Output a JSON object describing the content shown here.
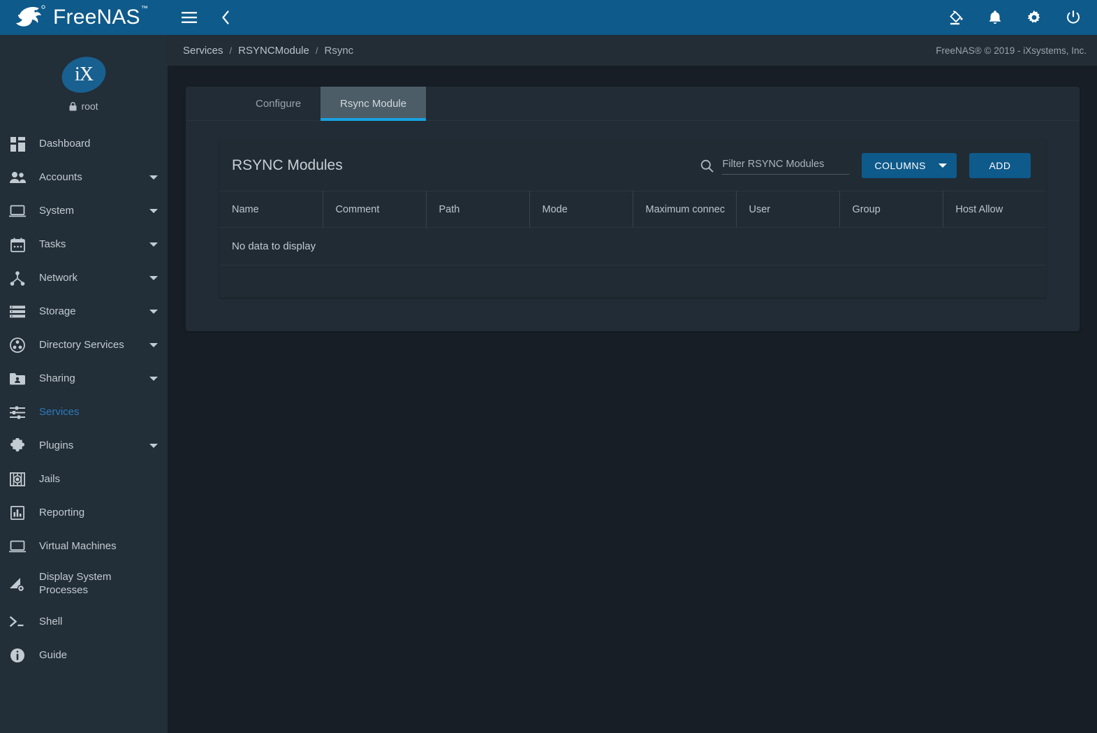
{
  "brand": {
    "name": "FreeNAS",
    "tm": "™",
    "logo_icon": "freenas-fish-logo"
  },
  "sidebar": {
    "user": {
      "name": "root",
      "avatar_text": "iX",
      "lock_icon": "lock-icon"
    },
    "items": [
      {
        "label": "Dashboard",
        "icon": "dashboard-icon",
        "expandable": false,
        "active": false
      },
      {
        "label": "Accounts",
        "icon": "accounts-icon",
        "expandable": true,
        "active": false
      },
      {
        "label": "System",
        "icon": "system-icon",
        "expandable": true,
        "active": false
      },
      {
        "label": "Tasks",
        "icon": "tasks-icon",
        "expandable": true,
        "active": false
      },
      {
        "label": "Network",
        "icon": "network-icon",
        "expandable": true,
        "active": false
      },
      {
        "label": "Storage",
        "icon": "storage-icon",
        "expandable": true,
        "active": false
      },
      {
        "label": "Directory Services",
        "icon": "directory-services-icon",
        "expandable": true,
        "active": false
      },
      {
        "label": "Sharing",
        "icon": "sharing-icon",
        "expandable": true,
        "active": false
      },
      {
        "label": "Services",
        "icon": "services-icon",
        "expandable": false,
        "active": true
      },
      {
        "label": "Plugins",
        "icon": "plugins-icon",
        "expandable": true,
        "active": false
      },
      {
        "label": "Jails",
        "icon": "jails-icon",
        "expandable": false,
        "active": false
      },
      {
        "label": "Reporting",
        "icon": "reporting-icon",
        "expandable": false,
        "active": false
      },
      {
        "label": "Virtual Machines",
        "icon": "virtual-machines-icon",
        "expandable": false,
        "active": false
      },
      {
        "label": "Display System Processes",
        "icon": "display-system-processes-icon",
        "expandable": false,
        "active": false
      },
      {
        "label": "Shell",
        "icon": "shell-icon",
        "expandable": false,
        "active": false
      },
      {
        "label": "Guide",
        "icon": "guide-icon",
        "expandable": false,
        "active": false
      }
    ]
  },
  "topbar": {
    "menu_icon": "hamburger-menu-icon",
    "back_icon": "chevron-left-icon",
    "actions": [
      {
        "icon": "theme-paint-icon",
        "label": "Change Theme"
      },
      {
        "icon": "bell-notification-icon",
        "label": "Notifications"
      },
      {
        "icon": "gear-settings-icon",
        "label": "Settings"
      },
      {
        "icon": "power-icon",
        "label": "Power"
      }
    ]
  },
  "breadcrumb": {
    "items": [
      "Services",
      "RSYNCModule",
      "Rsync"
    ],
    "separator": "/"
  },
  "copyright": "FreeNAS® © 2019 - iXsystems, Inc.",
  "tabs": [
    {
      "label": "Configure",
      "active": false
    },
    {
      "label": "Rsync Module",
      "active": true
    }
  ],
  "card": {
    "title": "RSYNC Modules",
    "search": {
      "icon": "search-icon",
      "placeholder": "Filter RSYNC Modules",
      "value": ""
    },
    "columns_button": {
      "label": "COLUMNS",
      "icon": "chevron-down-icon"
    },
    "add_button": {
      "label": "ADD"
    },
    "table": {
      "headers": [
        "Name",
        "Comment",
        "Path",
        "Mode",
        "Maximum connec",
        "User",
        "Group",
        "Host Allow"
      ],
      "rows": [],
      "empty_message": "No data to display"
    }
  },
  "colors": {
    "brand_blue": "#0e5a8a",
    "accent_blue": "#17a2e0",
    "active_nav": "#2b7bbd",
    "sidebar_bg": "#222e38",
    "page_bg": "#171e26",
    "panel_bg": "#222c36",
    "card_bg": "#212b34",
    "tab_active_bg": "#4c5d68"
  }
}
